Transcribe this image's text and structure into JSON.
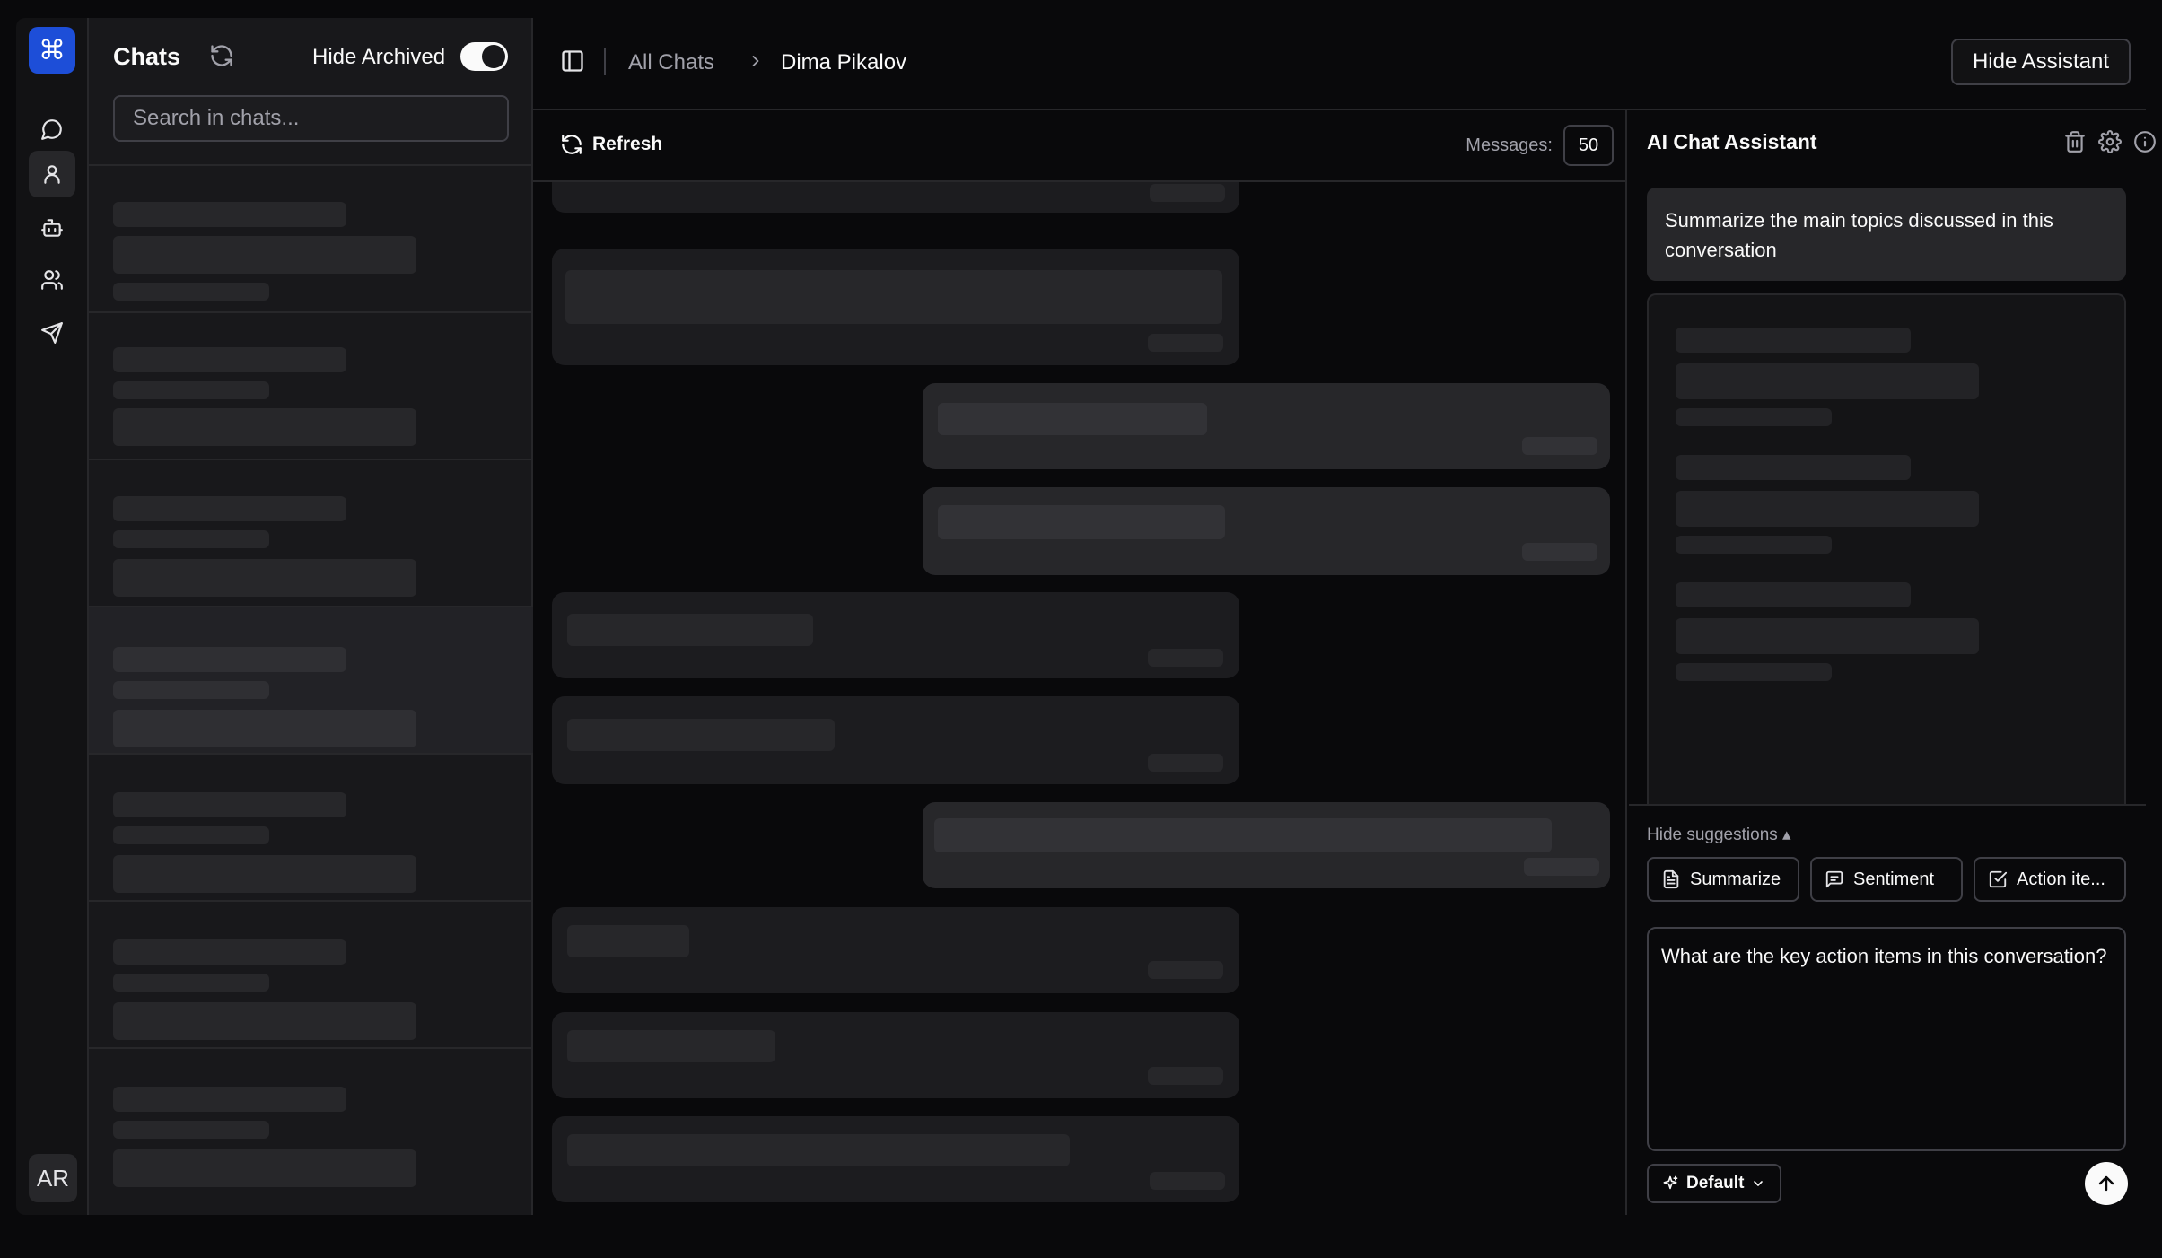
{
  "rail": {
    "logo_glyph": "⌘",
    "nav": [
      "chat-icon",
      "user-icon",
      "bot-icon",
      "users-icon",
      "send-icon"
    ],
    "active_index": 1,
    "avatar_initials": "AR"
  },
  "chatlist": {
    "title": "Chats",
    "hide_archived_label": "Hide Archived",
    "hide_archived_on": true,
    "search_placeholder": "Search in chats...",
    "selected_index": 3
  },
  "topbar": {
    "breadcrumb_root": "All Chats",
    "breadcrumb_current": "Dima Pikalov",
    "hide_assistant_label": "Hide Assistant"
  },
  "thread": {
    "refresh_label": "Refresh",
    "messages_label": "Messages:",
    "messages_count": "50"
  },
  "assistant": {
    "title": "AI Chat Assistant",
    "user_prompt": "Summarize the main topics discussed in this conversation",
    "hide_suggestions_label": "Hide suggestions ▴",
    "suggestions": [
      "Summarize",
      "Sentiment",
      "Action ite..."
    ],
    "input_value": "What are the key action items in this conversation?",
    "model_label": "Default"
  },
  "colors": {
    "background": "#09090b",
    "accent": "#1d4ed8",
    "panel": "#18181b",
    "border": "#27272a"
  }
}
